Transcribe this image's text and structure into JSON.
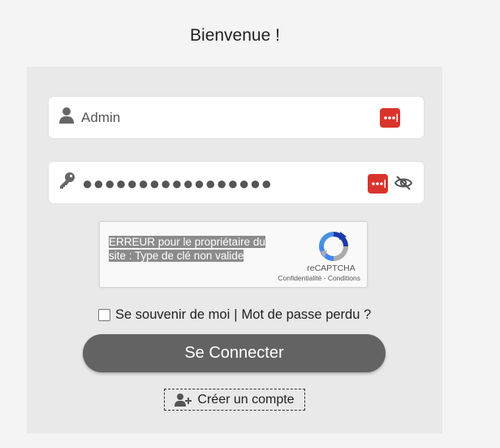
{
  "page": {
    "title": "Bienvenue !"
  },
  "login": {
    "username_value": "Admin",
    "password_mask": "●●●●●●●●●●●●●●●●●",
    "icons": {
      "user": "user-icon",
      "password": "key-icon",
      "password_manager": "password-manager-icon",
      "toggle": "eye-slash-icon"
    }
  },
  "captcha": {
    "error_text": "ERREUR pour le propriétaire du site : Type de clé non valide",
    "brand": "reCAPTCHA",
    "privacy_link": "Confidentialité",
    "links_separator": "-",
    "terms_link": "Conditions"
  },
  "options": {
    "remember_label": "Se souvenir de moi",
    "separator": "|",
    "forgot_password": "Mot de passe perdu ?"
  },
  "actions": {
    "login_button": "Se Connecter",
    "create_account": "Créer un compte"
  },
  "colors": {
    "badge_red": "#d9342b",
    "button_gray": "#636363",
    "panel_bg": "#e9e9e9",
    "page_bg": "#f4f4f4"
  }
}
